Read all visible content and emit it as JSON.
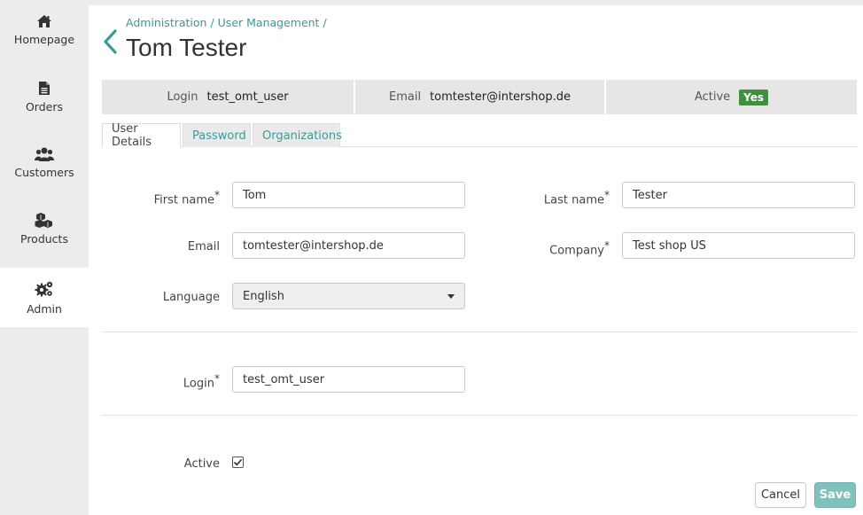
{
  "sidebar": {
    "items": [
      {
        "label": "Homepage",
        "icon": "home-icon"
      },
      {
        "label": "Orders",
        "icon": "document-icon"
      },
      {
        "label": "Customers",
        "icon": "users-icon"
      },
      {
        "label": "Products",
        "icon": "cubes-icon"
      },
      {
        "label": "Admin",
        "icon": "gears-icon",
        "active": true
      }
    ]
  },
  "breadcrumb": {
    "items": [
      "Administration",
      "User Management"
    ],
    "separator": "/"
  },
  "page": {
    "title": "Tom Tester"
  },
  "summary": {
    "login_label": "Login",
    "login_value": "test_omt_user",
    "email_label": "Email",
    "email_value": "tomtester@intershop.de",
    "active_label": "Active",
    "active_value": "Yes"
  },
  "tabs": [
    {
      "label": "User Details",
      "active": true
    },
    {
      "label": "Password",
      "active": false
    },
    {
      "label": "Organizations",
      "active": false
    }
  ],
  "form": {
    "first_name_label": "First name",
    "first_name_value": "Tom",
    "last_name_label": "Last name",
    "last_name_value": "Tester",
    "email_label": "Email",
    "email_value": "tomtester@intershop.de",
    "company_label": "Company",
    "company_value": "Test shop US",
    "language_label": "Language",
    "language_value": "English",
    "login_label": "Login",
    "login_value": "test_omt_user",
    "active_label": "Active",
    "active_checked": true,
    "required_marker": "*"
  },
  "actions": {
    "cancel_label": "Cancel",
    "save_label": "Save"
  },
  "colors": {
    "accent": "#3a9a98",
    "badge_green": "#3f8f3f",
    "save_button": "#7fc1bd"
  }
}
